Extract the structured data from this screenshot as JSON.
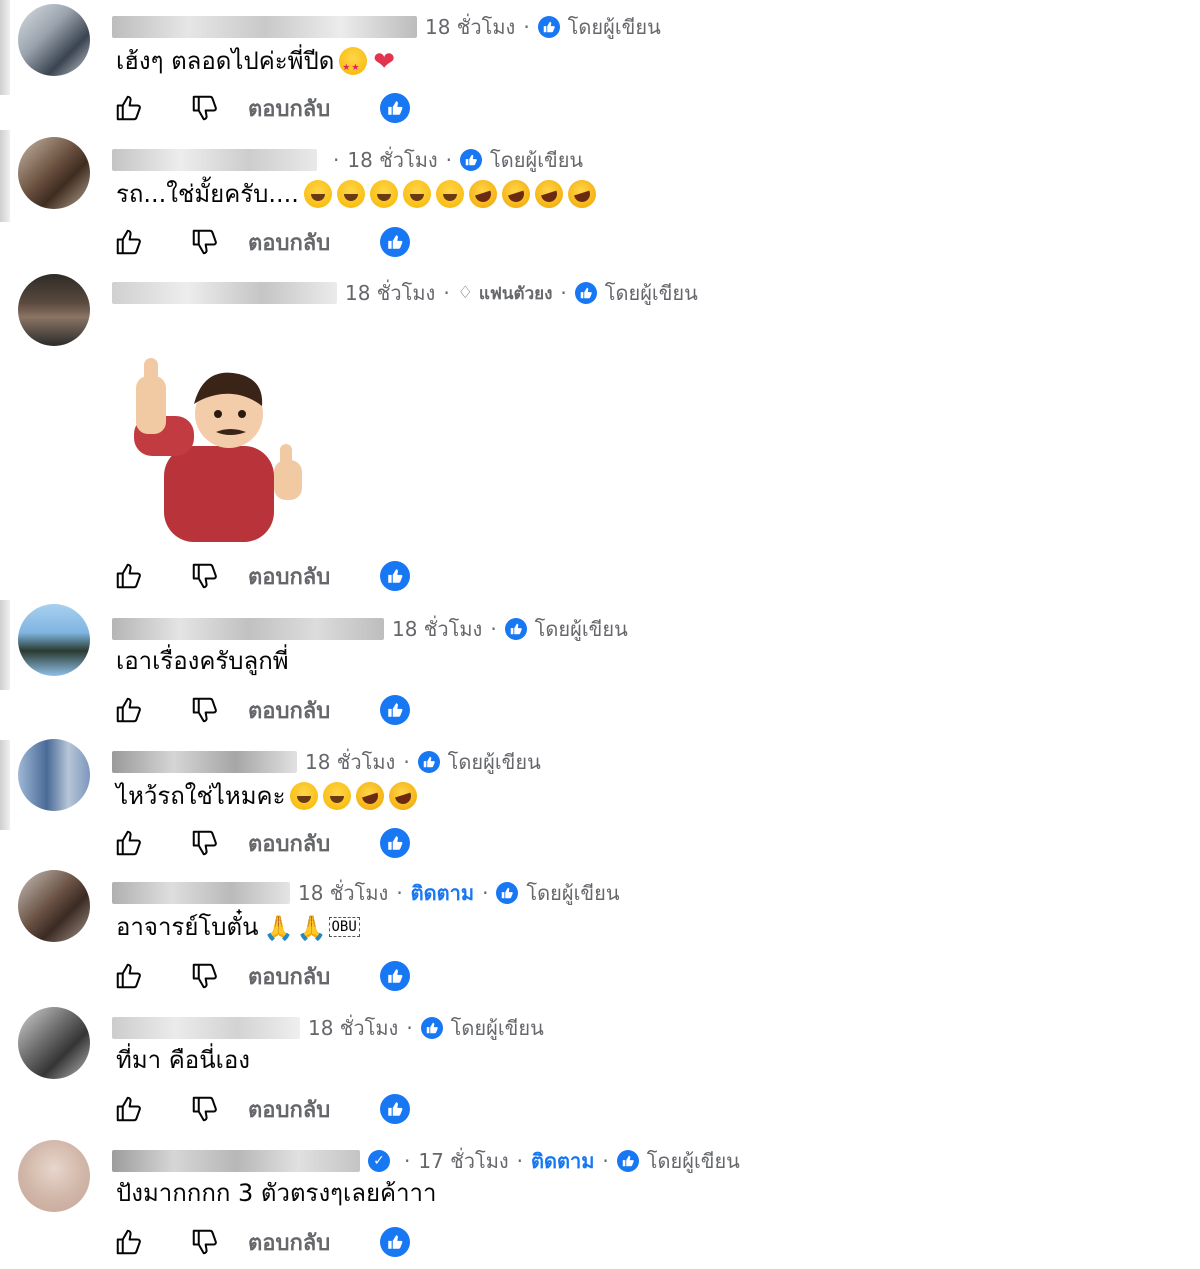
{
  "labels": {
    "reply": "ตอบกลับ",
    "by_author": "โดยผู้เขียน",
    "follow": "ติดตาม",
    "fan": "แฟนตัวยง"
  },
  "comments": [
    {
      "time": "18 ชั่วโมง",
      "text": "เฮ้งๆ ตลอดไปค่ะพี่ปีด",
      "emojis": [
        "star-eye",
        "heart"
      ]
    },
    {
      "time": "18 ชั่วโมง",
      "text": "รถ...ใช่มั้ยครับ....",
      "emojis": [
        "smile",
        "smile",
        "smile",
        "smile",
        "smile",
        "laugh",
        "laugh",
        "laugh",
        "laugh"
      ]
    },
    {
      "time": "18 ชั่วโมง",
      "text": "",
      "sticker": "thumbs-up-man-sticker"
    },
    {
      "time": "18 ชั่วโมง",
      "text": "เอาเรื่องครับลูกพี่"
    },
    {
      "time": "18 ชั่วโมง",
      "text": "ไหว้รถใช่ไหมคะ",
      "emojis": [
        "smile",
        "smile",
        "laugh",
        "laugh"
      ]
    },
    {
      "time": "18 ชั่วโมง",
      "text": "อาจารย์โบตั๋น",
      "emojis": [
        "pray",
        "pray"
      ],
      "badge_text": "OBU"
    },
    {
      "time": "18 ชั่วโมง",
      "text": "ที่มา คือนี่เอง"
    },
    {
      "time": "17 ชั่วโมง",
      "text": "ปังมากกกก 3 ตัวตรงๆเลยค้าาา"
    }
  ],
  "colors": {
    "accent": "#1877f2",
    "meta": "#65676b",
    "text": "#050505"
  }
}
